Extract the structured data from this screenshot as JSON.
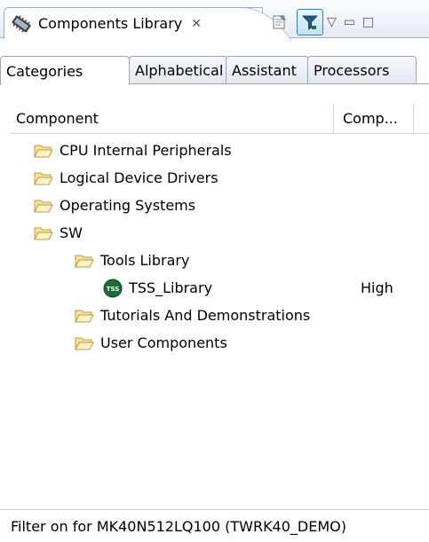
{
  "view_tab": {
    "title": "Components Library",
    "close_glyph": "✕",
    "icon": "components-library-icon"
  },
  "toolbar": {
    "buttons": [
      "properties-icon",
      "filter-icon"
    ],
    "view_menu_glyph": "▽",
    "minimize_glyph": "▭",
    "maximize_glyph": "□"
  },
  "tabs": [
    {
      "label": "Categories",
      "selected": true
    },
    {
      "label": "Alphabetical",
      "selected": false
    },
    {
      "label": "Assistant",
      "selected": false
    },
    {
      "label": "Processors",
      "selected": false
    }
  ],
  "table": {
    "columns": [
      "Component",
      "Comp..."
    ],
    "rows": [
      {
        "label": "CPU Internal Peripherals",
        "level": 1,
        "icon": "folder-open-icon",
        "comp": ""
      },
      {
        "label": "Logical Device Drivers",
        "level": 1,
        "icon": "folder-open-icon",
        "comp": ""
      },
      {
        "label": "Operating Systems",
        "level": 1,
        "icon": "folder-open-icon",
        "comp": ""
      },
      {
        "label": "SW",
        "level": 1,
        "icon": "folder-open-icon",
        "comp": ""
      },
      {
        "label": "Tools Library",
        "level": 2,
        "icon": "folder-open-icon",
        "comp": ""
      },
      {
        "label": "TSS_Library",
        "level": 3,
        "icon": "tss-component-icon",
        "icon_text": "TSS",
        "comp": "High"
      },
      {
        "label": "Tutorials And Demonstrations",
        "level": 2,
        "icon": "folder-open-icon",
        "comp": ""
      },
      {
        "label": "User Components",
        "level": 2,
        "icon": "folder-open-icon",
        "comp": ""
      }
    ]
  },
  "status": {
    "text": "Filter on for MK40N512LQ100 (TWRK40_DEMO)"
  },
  "colors": {
    "folder_fill": "#f7e3a1",
    "folder_stroke": "#c39a3c",
    "tss_fill": "#1f6b3a",
    "filter_active": "#3c7fb1"
  }
}
